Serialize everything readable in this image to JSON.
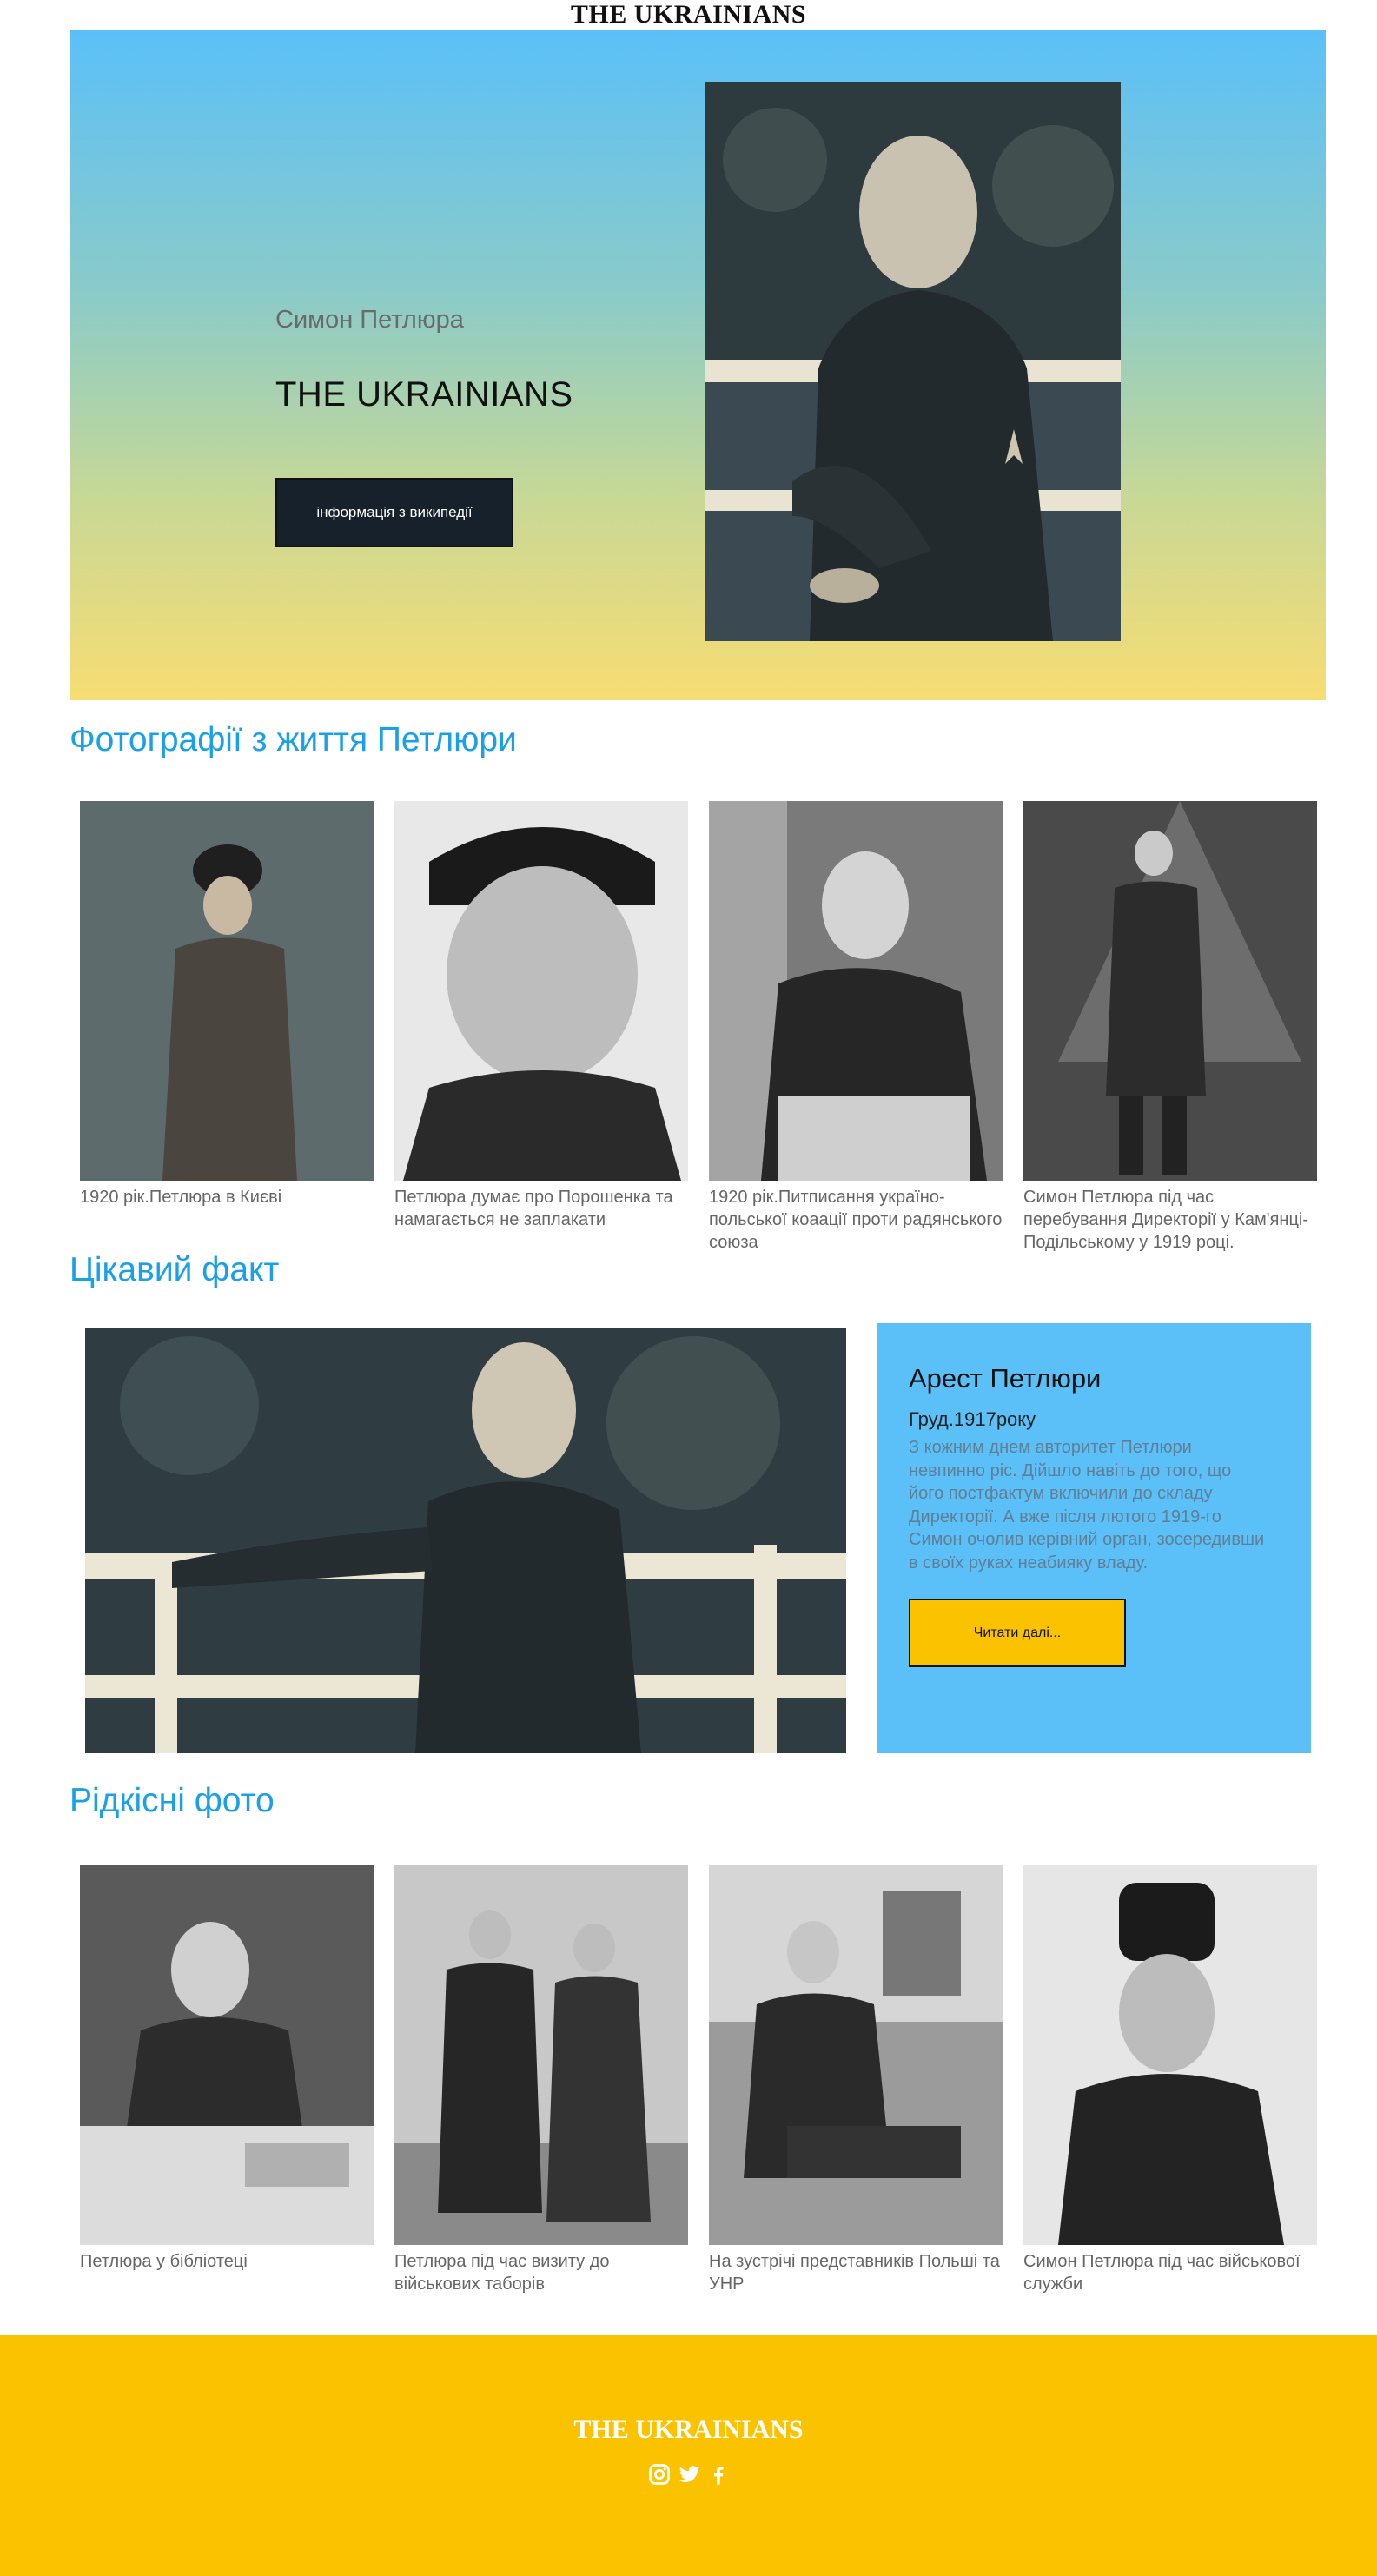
{
  "header": {
    "brand": "THE UKRAINIANS"
  },
  "hero": {
    "subtitle": "Симон Петлюра",
    "title": "THE UKRAINIANS",
    "button_label": "інформація з википедії"
  },
  "section_life": {
    "title": "Фотографії з життя Петлюри",
    "cards": [
      {
        "caption": "1920 рік.Петлюра в Києві"
      },
      {
        "caption": "Петлюра думає про Порошенка та намагається не заплакати"
      },
      {
        "caption": "1920 рік.Питписання україно-польської коаації проти радянського союза"
      },
      {
        "caption": "Симон Петлюра під час перебування Директорії у Кам'янці-Подільському у 1919 році."
      }
    ]
  },
  "section_fact": {
    "title": "Цікавий факт",
    "heading": "Арест Петлюри",
    "date": "Груд.1917року",
    "text": "З кожним днем авторитет Петлюри невпинно ріс. Дійшло навіть до того, що його постфактум включили до складу Директорії. А вже після лютого 1919-го Симон очолив керівний орган, зосередивши в своїх руках неабияку владу.",
    "button_label": "Читати далі..."
  },
  "section_rare": {
    "title": "Рідкісні фото",
    "cards": [
      {
        "caption": "Петлюра у бібліотеці"
      },
      {
        "caption": "Петлюра під час визиту до військових таборів"
      },
      {
        "caption": "На зустрічі представників Польші та УНР"
      },
      {
        "caption": "Симон Петлюра під час військової служби"
      }
    ]
  },
  "footer": {
    "brand": "THE UKRAINIANS",
    "icons": [
      "instagram-icon",
      "twitter-icon",
      "facebook-icon"
    ]
  },
  "colors": {
    "accent_blue": "#1aa0e8",
    "sky": "#5bc0f8",
    "yellow": "#fbc200",
    "dark_button": "#17212b"
  }
}
